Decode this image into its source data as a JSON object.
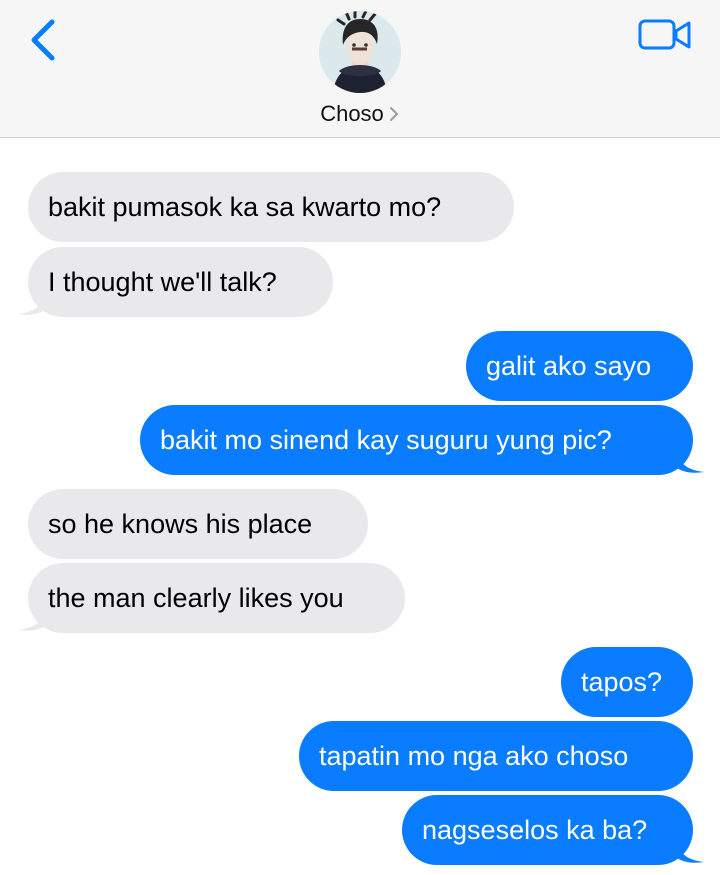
{
  "header": {
    "contact_name": "Choso",
    "back_icon": "chevron-left-icon",
    "video_icon": "video-camera-icon",
    "accent_color": "#0a7cff"
  },
  "messages": [
    {
      "direction": "incoming",
      "text": "bakit pumasok ka sa kwarto mo?"
    },
    {
      "direction": "incoming",
      "text": "I thought we'll talk?"
    },
    {
      "direction": "outgoing",
      "text": "galit ako sayo"
    },
    {
      "direction": "outgoing",
      "text": "bakit mo sinend kay suguru yung pic?"
    },
    {
      "direction": "incoming",
      "text": "so he knows his place"
    },
    {
      "direction": "incoming",
      "text": "the man clearly likes you"
    },
    {
      "direction": "outgoing",
      "text": "tapos?"
    },
    {
      "direction": "outgoing",
      "text": "tapatin mo nga ako choso"
    },
    {
      "direction": "outgoing",
      "text": "nagseselos ka ba?"
    }
  ],
  "colors": {
    "incoming_bubble": "#e9e9eb",
    "outgoing_bubble": "#0a7cff"
  }
}
